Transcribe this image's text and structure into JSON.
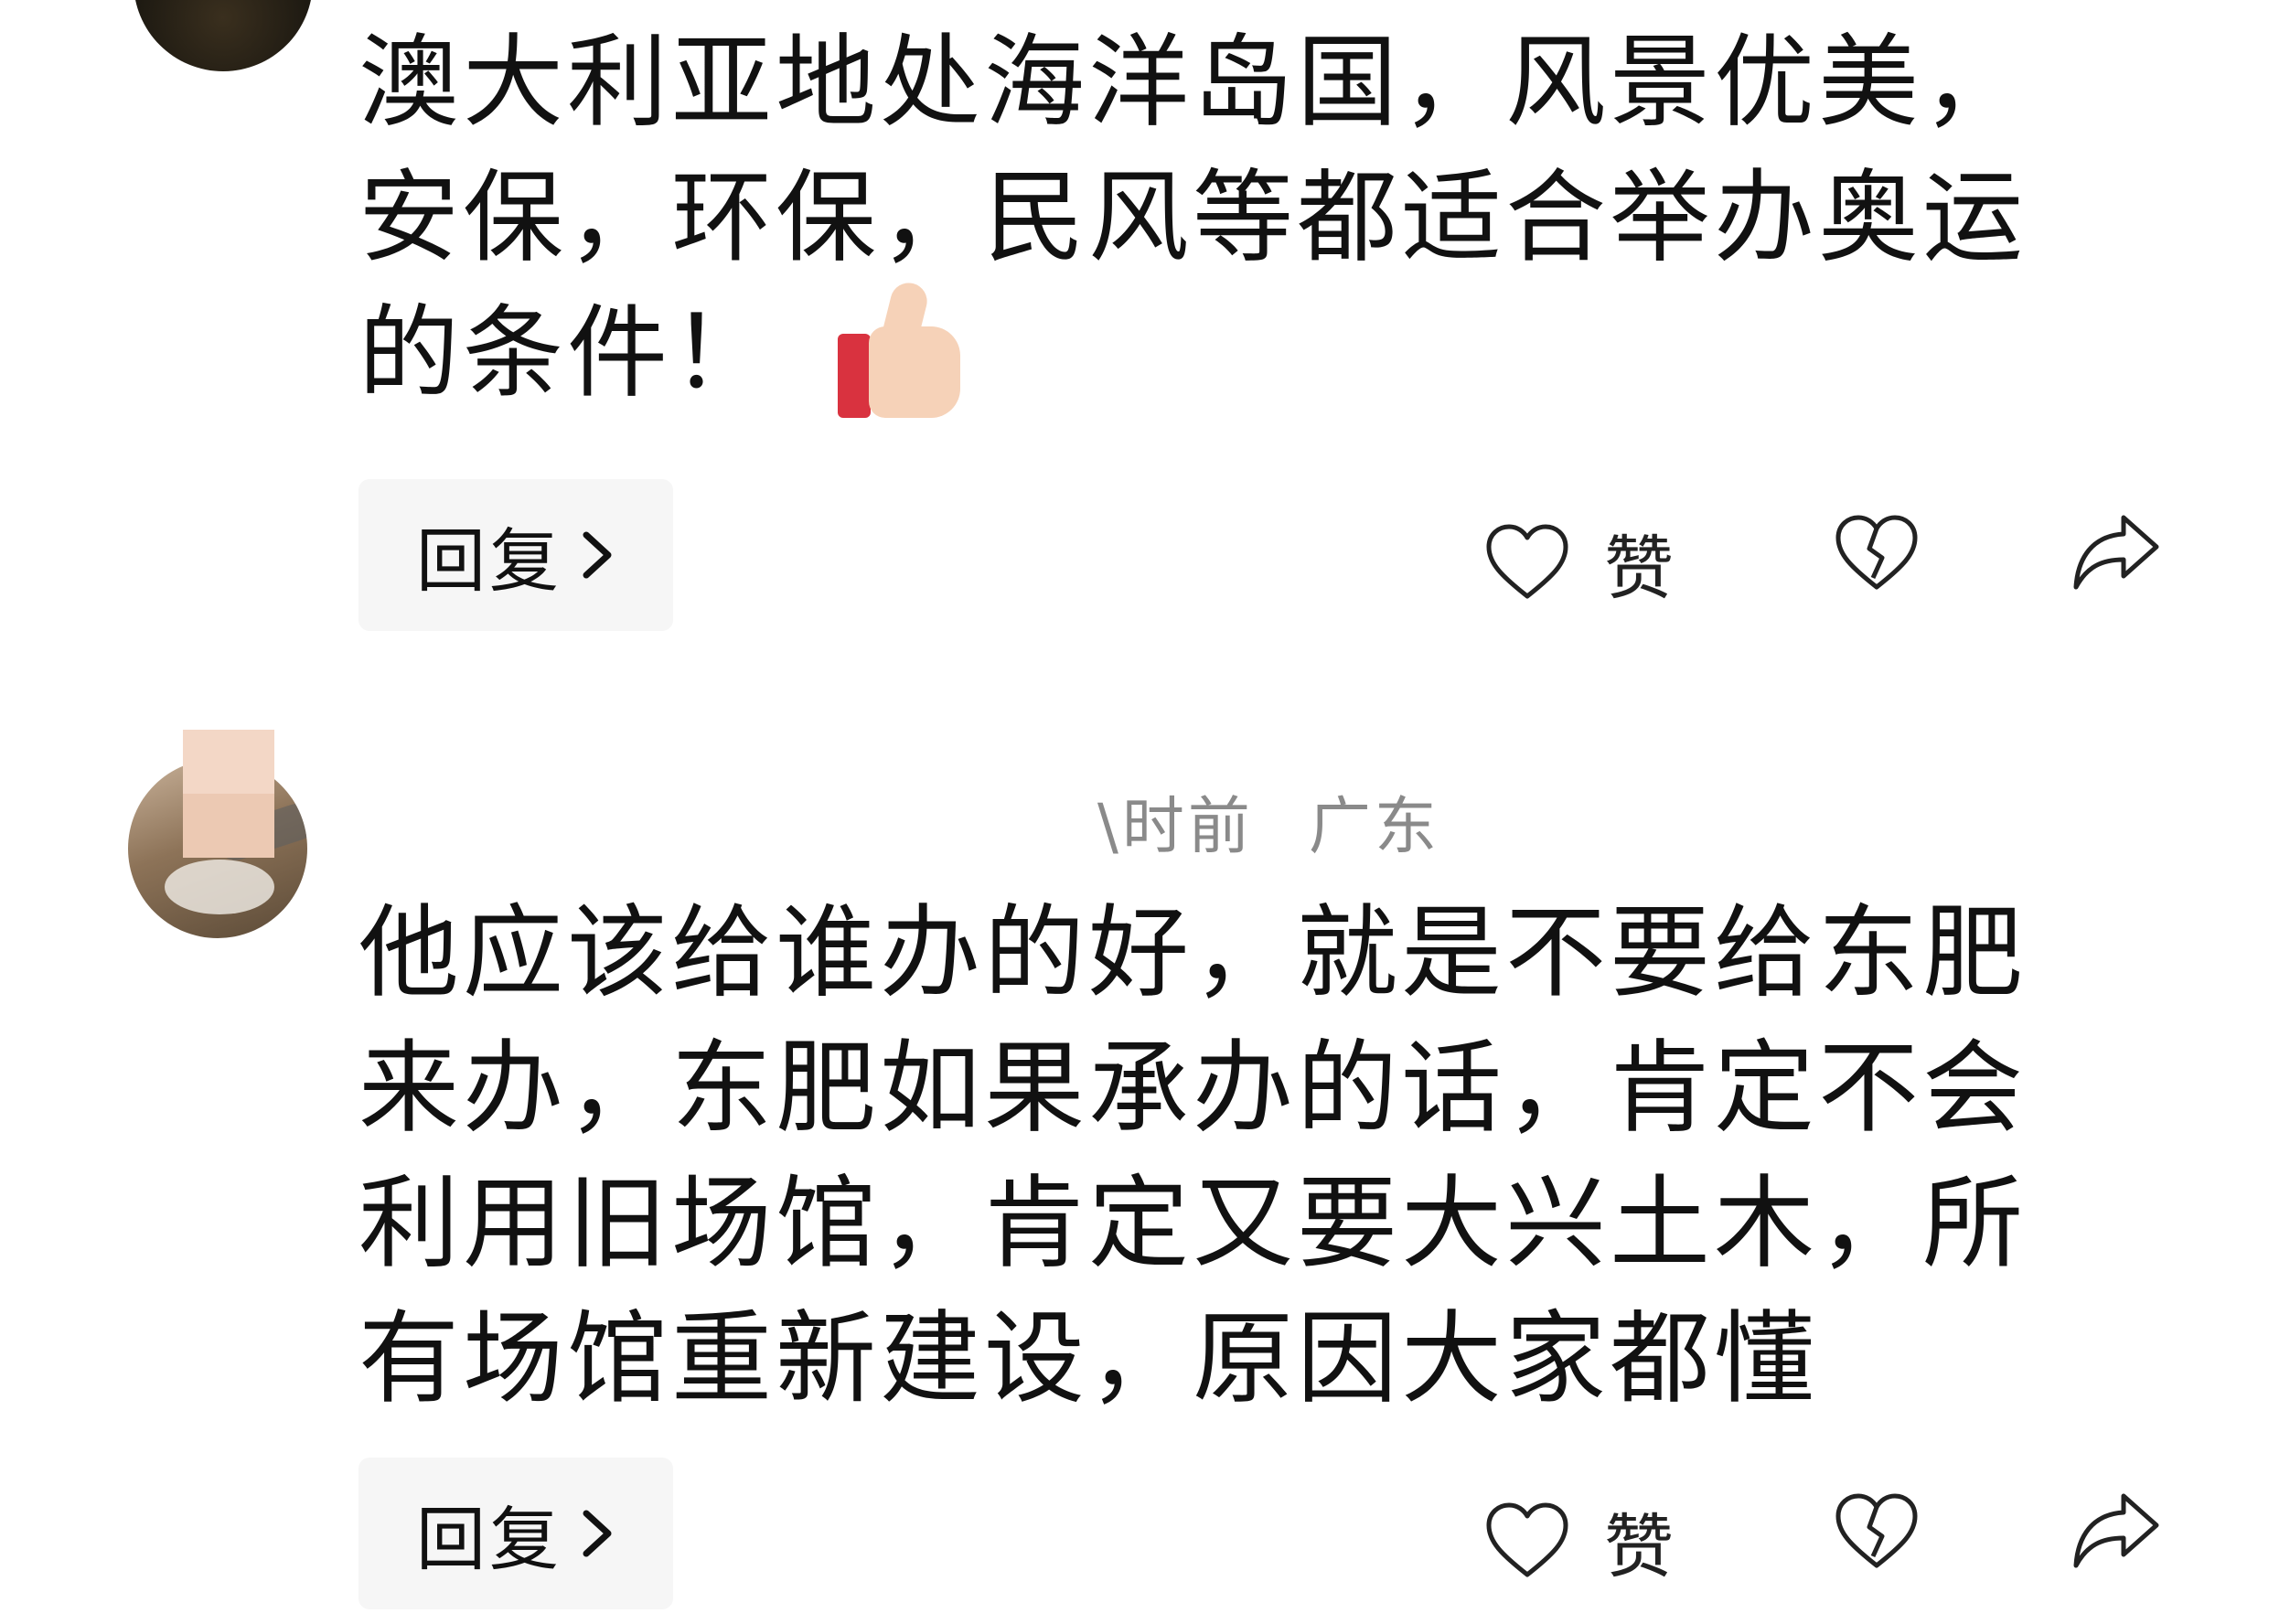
{
  "comments": [
    {
      "text": "澳大利亚地处海洋岛国，风景优美，安保，环保，民风等都适合举办奥运的条件！",
      "emoji": "thumbs-up",
      "reply_label": "回复",
      "like_label": "赞"
    },
    {
      "time": "\\时前",
      "location": "广东",
      "text": "他应该给谁办的好，就是不要给东肥来办，东肥如果承办的话，肯定不会利用旧场馆，肯定又要大兴土木，所有场馆重新建设，原因大家都懂",
      "reply_label": "回复",
      "like_label": "赞"
    }
  ],
  "icons": {
    "like": "heart-outline-icon",
    "dislike": "broken-heart-icon",
    "share": "share-arrow-icon",
    "reply_chevron": "chevron-right-icon"
  }
}
